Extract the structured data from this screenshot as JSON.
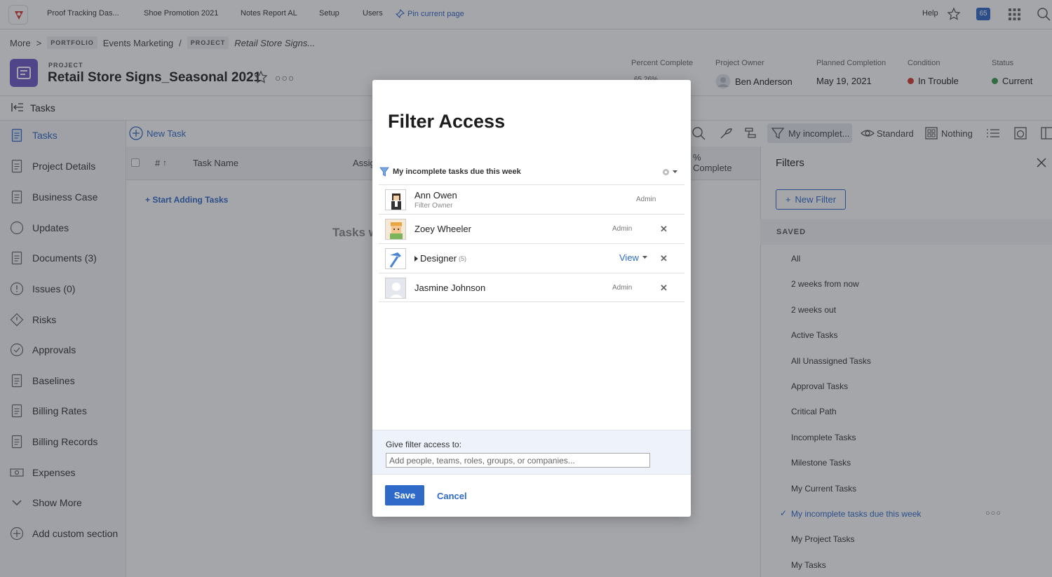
{
  "topnav": {
    "links": [
      "Proof Tracking Das...",
      "Shoe Promotion 2021",
      "Notes Report AL",
      "Setup",
      "Users"
    ],
    "pin_label": "Pin current page",
    "help": "Help",
    "notification_count": "65"
  },
  "breadcrumb": {
    "more": "More",
    "sep1": ">",
    "portfolio_tag": "PORTFOLIO",
    "portfolio": "Events Marketing",
    "sep2": "/",
    "project_tag": "PROJECT",
    "project": "Retail Store Signs..."
  },
  "project": {
    "tag": "PROJECT",
    "title": "Retail Store Signs_Seasonal 2021",
    "percent_complete_label": "Percent Complete",
    "percent_complete": "65.26%",
    "owner_label": "Project Owner",
    "owner": "Ben Anderson",
    "planned_label": "Planned Completion",
    "planned": "May 19, 2021",
    "condition_label": "Condition",
    "condition": "In Trouble",
    "status_label": "Status",
    "status": "Current"
  },
  "colors": {
    "accent": "#2f6ac8",
    "trouble": "#d33a2f",
    "current": "#3a9a48",
    "project_icon": "#6e59c8"
  },
  "tasks_header": "Tasks",
  "sidebar": {
    "items": [
      {
        "label": "Tasks",
        "icon": "tasks-icon"
      },
      {
        "label": "Project Details",
        "icon": "document-icon"
      },
      {
        "label": "Business Case",
        "icon": "briefcase-icon"
      },
      {
        "label": "Updates",
        "icon": "chat-icon"
      },
      {
        "label": "Documents (3)",
        "icon": "file-icon"
      },
      {
        "label": "Issues (0)",
        "icon": "issue-icon"
      },
      {
        "label": "Risks",
        "icon": "risk-icon"
      },
      {
        "label": "Approvals",
        "icon": "check-circle-icon"
      },
      {
        "label": "Baselines",
        "icon": "baseline-icon"
      },
      {
        "label": "Billing Rates",
        "icon": "list-icon"
      },
      {
        "label": "Billing Records",
        "icon": "record-icon"
      },
      {
        "label": "Expenses",
        "icon": "money-icon"
      },
      {
        "label": "Show More",
        "icon": "chevron-down-icon"
      },
      {
        "label": "Add custom section",
        "icon": "plus-circle-icon"
      }
    ]
  },
  "toolbar": {
    "new_task": "New Task",
    "filter": "My incomplet...",
    "view": "Standard",
    "grouping": "Nothing"
  },
  "grid": {
    "columns": [
      "#",
      "Task Name",
      "Assig",
      "%",
      "Complete"
    ],
    "start_adding": "+ Start Adding Tasks",
    "empty_text": "Tasks w"
  },
  "filters_panel": {
    "title": "Filters",
    "new_filter": "New Filter",
    "saved_label": "SAVED",
    "items": [
      "All",
      "2 weeks from now",
      "2 weeks out",
      "Active Tasks",
      "All Unassigned Tasks",
      "Approval Tasks",
      "Critical Path",
      "Incomplete Tasks",
      "Milestone Tasks",
      "My Current Tasks",
      "My incomplete tasks due this week",
      "My Project Tasks",
      "My Tasks"
    ],
    "selected": "My incomplete tasks due this week"
  },
  "modal": {
    "title": "Filter Access",
    "filter_name": "My incomplete tasks due this week",
    "people": [
      {
        "name": "Ann Owen",
        "sub": "Filter Owner",
        "role": "Admin"
      },
      {
        "name": "Zoey Wheeler",
        "role": "Admin"
      },
      {
        "name": "Designer",
        "count": "(5)",
        "access": "View"
      },
      {
        "name": "Jasmine Johnson",
        "role": "Admin"
      }
    ],
    "give_label": "Give filter access to:",
    "give_placeholder": "Add people, teams, roles, groups, or companies...",
    "save": "Save",
    "cancel": "Cancel"
  }
}
